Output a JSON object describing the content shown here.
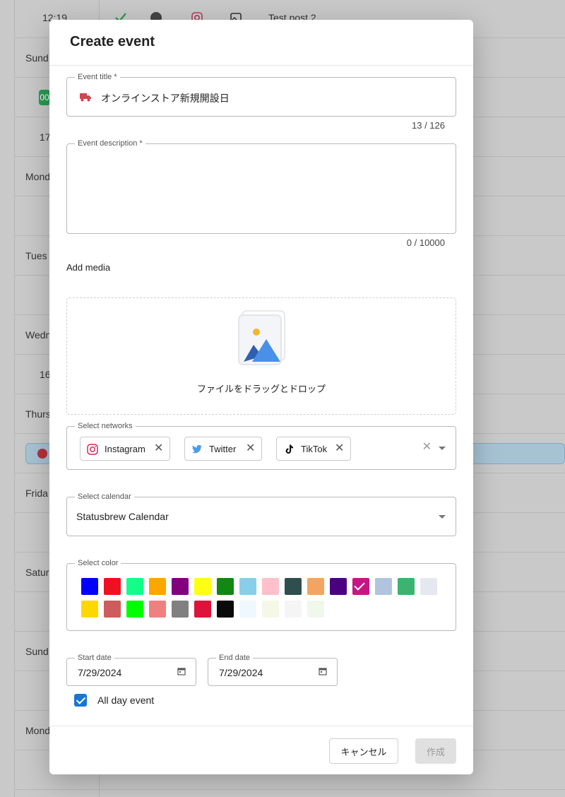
{
  "background": {
    "top_time": "12:19",
    "top_post": "Test post 2",
    "day_labels": [
      "Sund",
      "Mond",
      "Tues",
      "Wedn",
      "Thurs",
      "Frida",
      "Satur",
      "Sund",
      "Mond"
    ],
    "times": [
      "17",
      "16"
    ],
    "chip_text": "00"
  },
  "modal": {
    "title": "Create event",
    "event_title": {
      "legend": "Event title *",
      "value": "オンラインストア新規開設日",
      "counter": "13 / 126"
    },
    "event_description": {
      "legend": "Event description *",
      "value": "",
      "counter": "0 / 10000"
    },
    "add_media": {
      "label": "Add media",
      "dropzone_hint": "ファイルをドラッグとドロップ"
    },
    "networks": {
      "legend": "Select networks",
      "chips": [
        {
          "label": "Instagram",
          "icon": "instagram-icon"
        },
        {
          "label": "Twitter",
          "icon": "twitter-icon"
        },
        {
          "label": "TikTok",
          "icon": "tiktok-icon"
        }
      ]
    },
    "calendar": {
      "legend": "Select calendar",
      "value": "Statusbrew Calendar"
    },
    "color": {
      "legend": "Select color",
      "swatches": [
        "#0000ff",
        "#ee1122",
        "#11ff88",
        "#ffa500",
        "#800080",
        "#ffff11",
        "#118811",
        "#87ceeb",
        "#ffc0cb",
        "#2f4f4f",
        "#f4a460",
        "#4b0082",
        "#c71585",
        "#b0c4de",
        "#3cb371",
        "#e6e8ef",
        "#ffd700",
        "#cd5c5c",
        "#00ff00",
        "#f08080",
        "#808080",
        "#dc143c",
        "#0a0a0a",
        "#f0f8ff",
        "#f5f8e6",
        "#f5f5f5",
        "#f0f8ec"
      ],
      "selected_index": 12
    },
    "start_date": {
      "legend": "Start date",
      "value": "7/29/2024"
    },
    "end_date": {
      "legend": "End date",
      "value": "7/29/2024"
    },
    "all_day": {
      "label": "All day event",
      "checked": true
    },
    "footer": {
      "cancel_label": "キャンセル",
      "create_label": "作成"
    }
  }
}
